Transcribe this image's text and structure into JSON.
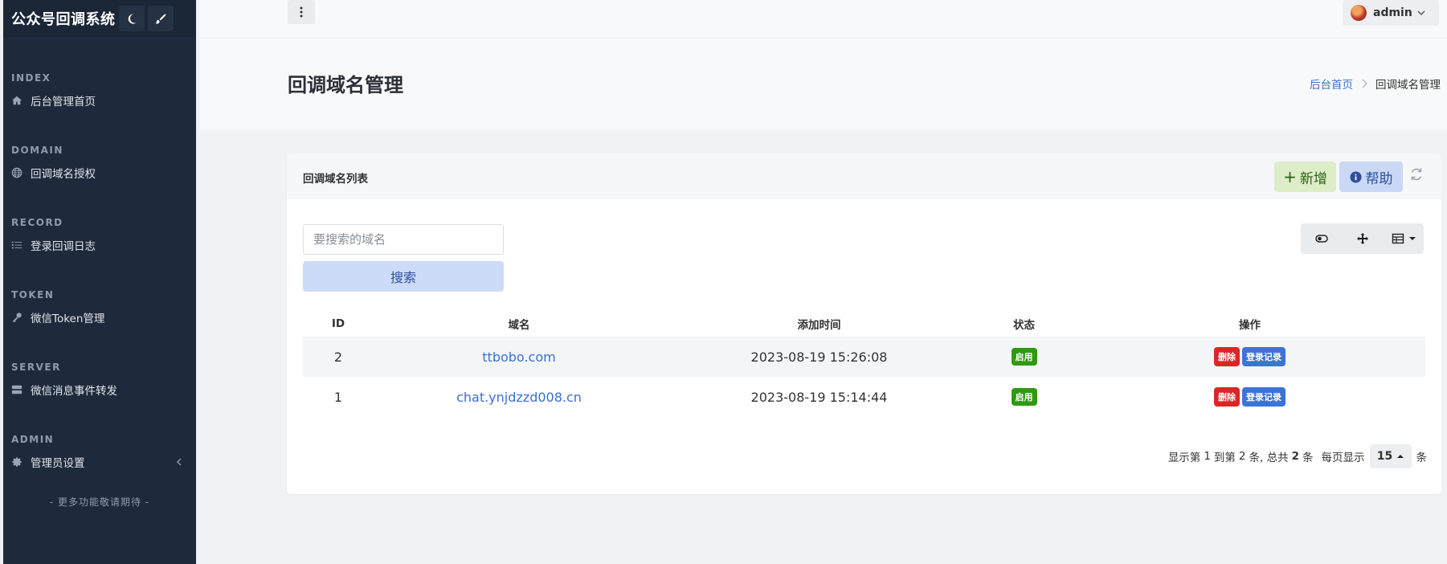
{
  "sidebar": {
    "brand": "公众号回调系统",
    "sections": [
      {
        "heading": "INDEX",
        "item": "后台管理首页",
        "icon": "home-icon"
      },
      {
        "heading": "DOMAIN",
        "item": "回调域名授权",
        "icon": "globe-icon"
      },
      {
        "heading": "RECORD",
        "item": "登录回调日志",
        "icon": "list-icon"
      },
      {
        "heading": "TOKEN",
        "item": "微信Token管理",
        "icon": "key-icon"
      },
      {
        "heading": "SERVER",
        "item": "微信消息事件转发",
        "icon": "server-icon"
      },
      {
        "heading": "ADMIN",
        "item": "管理员设置",
        "icon": "gear-icon"
      }
    ],
    "more": "- 更多功能敬请期待 -"
  },
  "topbar": {
    "user": "admin"
  },
  "header": {
    "title": "回调域名管理",
    "breadcrumb_home": "后台首页",
    "breadcrumb_current": "回调域名管理"
  },
  "card": {
    "title": "回调域名列表",
    "add_label": "新增",
    "help_label": "帮助",
    "search_placeholder": "要搜索的域名",
    "search_button": "搜索"
  },
  "table": {
    "columns": [
      "ID",
      "域名",
      "添加时间",
      "状态",
      "操作"
    ],
    "rows": [
      {
        "id": "2",
        "domain": "ttbobo.com",
        "added": "2023-08-19 15:26:08",
        "status": "启用",
        "delete": "删除",
        "log": "登录记录"
      },
      {
        "id": "1",
        "domain": "chat.ynjdzzd008.cn",
        "added": "2023-08-19 15:14:44",
        "status": "启用",
        "delete": "删除",
        "log": "登录记录"
      }
    ]
  },
  "pagination": {
    "prefix": "显示第",
    "from": "1",
    "to_label": "到第",
    "to": "2",
    "total_label": "条, 总共",
    "total": "2",
    "total_unit": "条",
    "per_page_label": "每页显示",
    "per_page": "15",
    "unit": "条"
  },
  "colors": {
    "sidebar_bg": "#1e2a3b",
    "link": "#3a6fd6",
    "success": "#2e9a12",
    "danger": "#dc2626",
    "primary": "#3b74d9"
  }
}
